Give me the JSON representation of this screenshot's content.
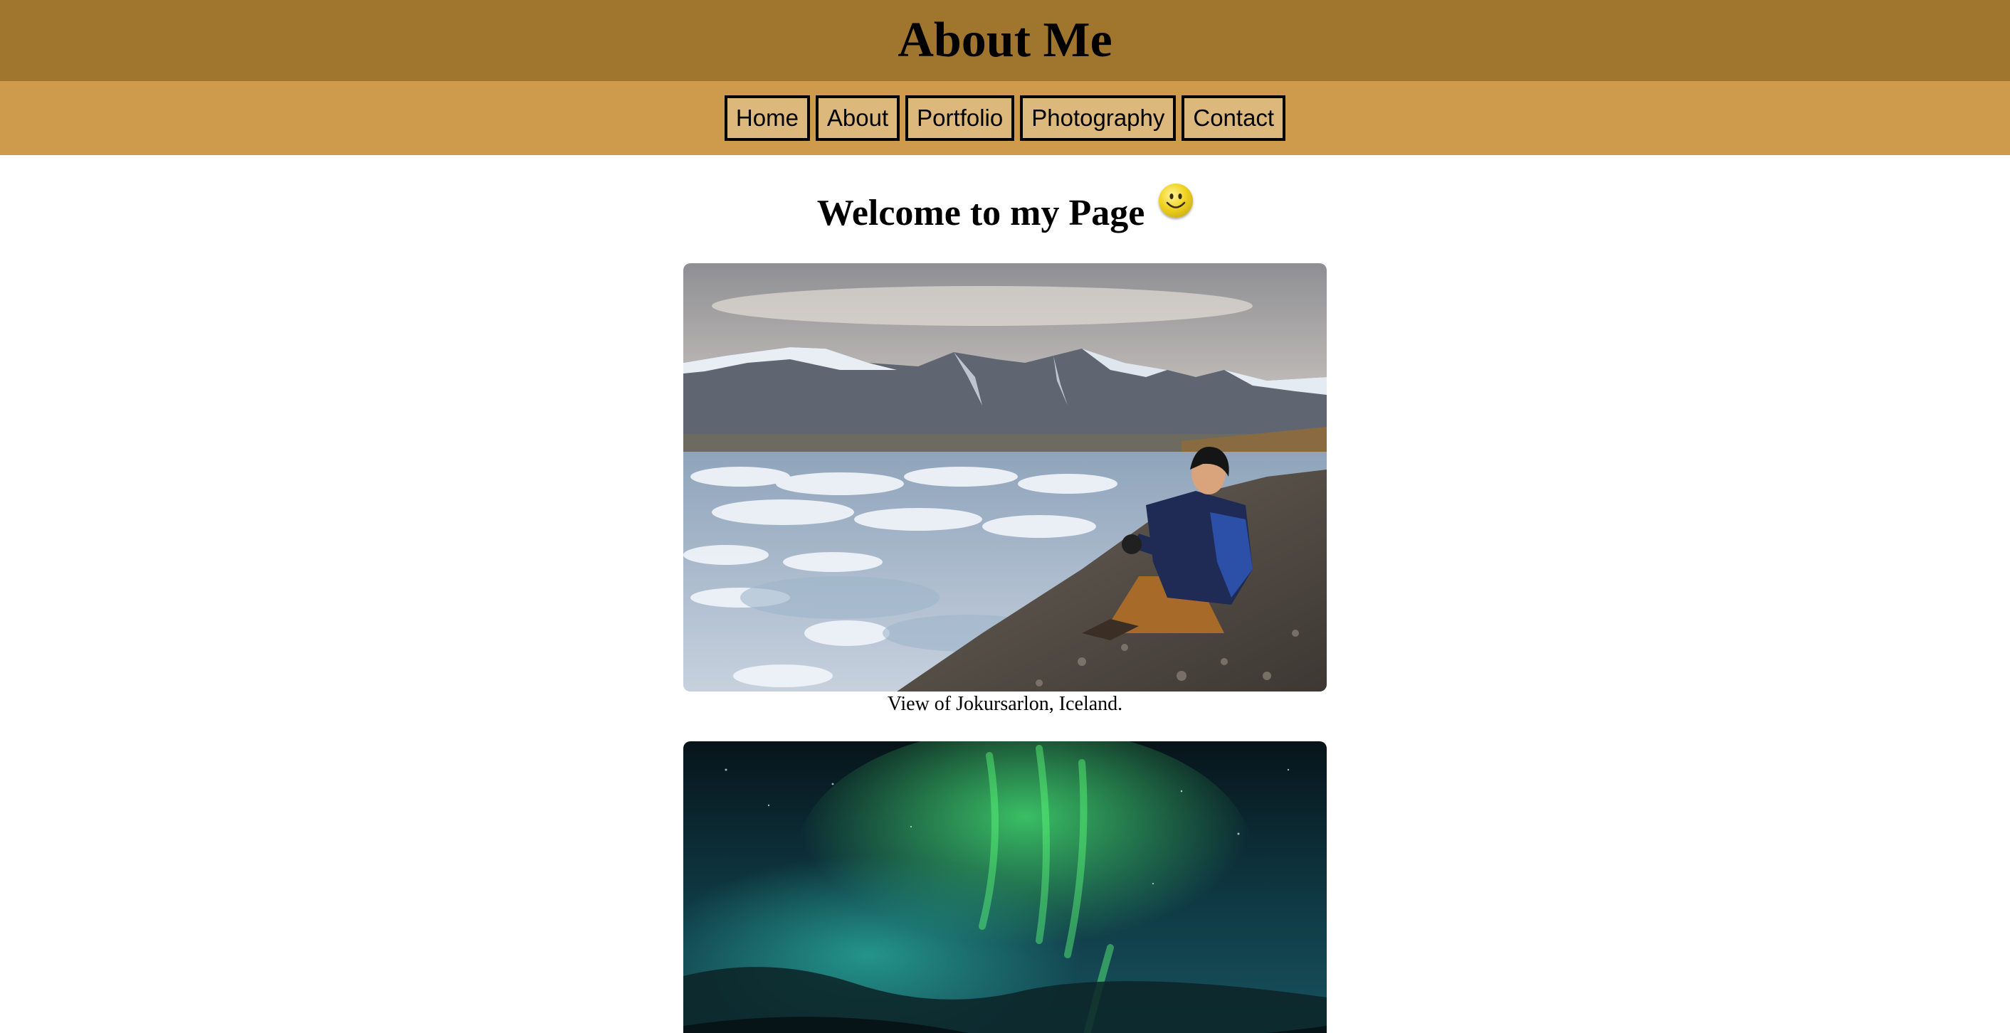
{
  "header": {
    "title": "About Me",
    "background": "#a0752d"
  },
  "nav": {
    "background": "#cd9b4b",
    "items": [
      {
        "label": "Home"
      },
      {
        "label": "About"
      },
      {
        "label": "Portfolio"
      },
      {
        "label": "Photography"
      },
      {
        "label": "Contact"
      }
    ]
  },
  "main": {
    "welcome": "Welcome to my Page",
    "welcome_icon": "smiley-face-icon",
    "figures": [
      {
        "caption": "View of Jokursarlon, Iceland.",
        "image": "glacier-lagoon-photo"
      },
      {
        "caption": "",
        "image": "aurora-borealis-photo"
      }
    ]
  }
}
